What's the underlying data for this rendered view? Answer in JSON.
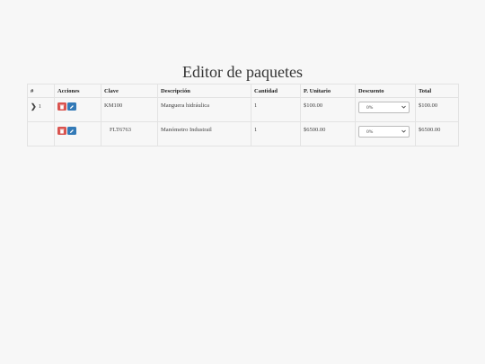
{
  "title": "Editor de paquetes",
  "columns": [
    "#",
    "Acciones",
    "Clave",
    "Descripción",
    "Cantidad",
    "P. Unitario",
    "Descuento",
    "Total"
  ],
  "rows": [
    {
      "num": "1",
      "clave": "KM100",
      "descripcion": "Manguera hidráulica",
      "cantidad": "1",
      "unitario": "$100.00",
      "descuento": "0%",
      "total": "$100.00"
    },
    {
      "num": "",
      "clave": "FLT6763",
      "descripcion": "Manómetro Industrail",
      "cantidad": "1",
      "unitario": "$6500.00",
      "descuento": "0%",
      "total": "$6500.00"
    }
  ],
  "icons": {
    "expand": "chevron-right-icon",
    "delete": "trash-icon",
    "edit": "pencil-icon",
    "dropdown": "chevron-down-icon"
  },
  "colors": {
    "delete": "#d9534f",
    "edit": "#337ab7"
  }
}
